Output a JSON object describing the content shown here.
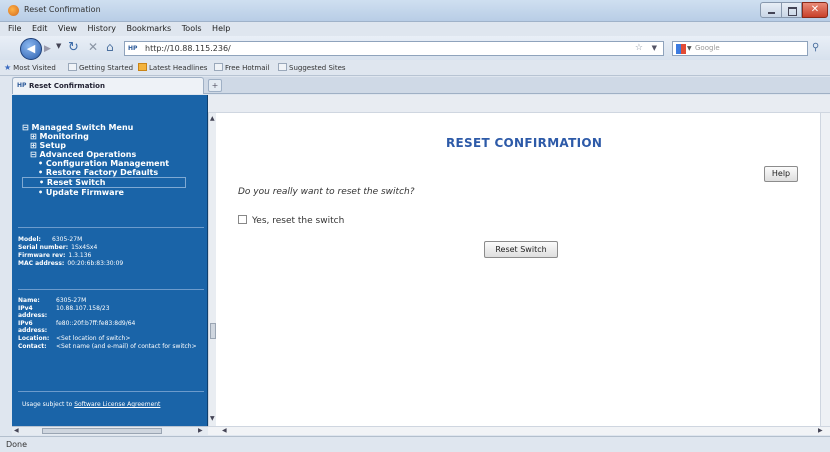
{
  "window": {
    "title": "Reset Confirmation",
    "close_glyph": "✕"
  },
  "menubar": {
    "items": [
      "File",
      "Edit",
      "View",
      "History",
      "Bookmarks",
      "Tools",
      "Help"
    ]
  },
  "navbar": {
    "url": "http://10.88.115.236/",
    "search_placeholder": "Google"
  },
  "bookmarks": {
    "items": [
      "Most Visited",
      "Getting Started",
      "Latest Headlines",
      "Free Hotmail",
      "Suggested Sites"
    ]
  },
  "tab": {
    "label": "Reset Confirmation"
  },
  "sidebar": {
    "menu": {
      "root": "Managed Switch Menu",
      "monitoring": "Monitoring",
      "setup": "Setup",
      "advanced": "Advanced Operations",
      "config_mgmt": "Configuration Management",
      "factory_defaults": "Restore Factory Defaults",
      "reset_switch": "Reset Switch",
      "update_firmware": "Update Firmware"
    },
    "device_info": {
      "model_label": "Model:",
      "model_value": "6305-27M",
      "serial_label": "Serial number:",
      "serial_value": "1Sx4Sx4",
      "firmware_label": "Firmware rev:",
      "firmware_value": "1.3.136",
      "mac_label": "MAC address:",
      "mac_value": "00:20:6b:83:30:09"
    },
    "network_info": {
      "name_label": "Name:",
      "name_value": "6305-27M",
      "ipv4_label": "IPv4 address:",
      "ipv4_value": "10.88.107.158/23",
      "ipv6_label": "IPv6 address:",
      "ipv6_value": "fe80::20f:b7ff:fe83:8d9/64",
      "location_label": "Location:",
      "location_value": "<Set location of switch>",
      "contact_label": "Contact:",
      "contact_value": "<Set name (and e-mail) of contact for switch>"
    },
    "license": {
      "prefix": "Usage subject to",
      "link": "Software License Agreement"
    }
  },
  "main": {
    "page_title": "RESET CONFIRMATION",
    "help_button": "Help",
    "question": "Do you really want to reset the switch?",
    "confirm_checkbox_label": "Yes, reset the switch",
    "confirm_checked": false,
    "reset_button": "Reset Switch"
  },
  "statusbar": {
    "status": "Done"
  }
}
